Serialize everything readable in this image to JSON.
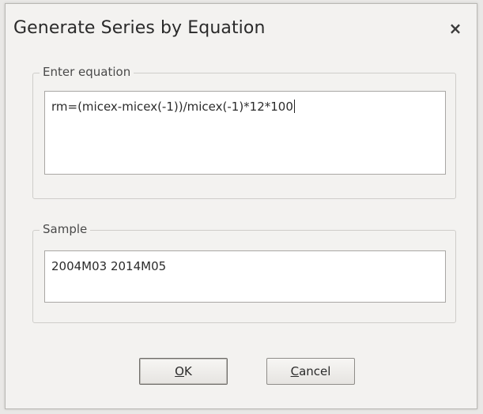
{
  "dialog": {
    "title": "Generate Series by Equation",
    "close_icon": "close-icon"
  },
  "equation_group": {
    "label": "Enter equation",
    "value": "rm=(micex-micex(-1))/micex(-1)*12*100"
  },
  "sample_group": {
    "label": "Sample",
    "value": "2004M03 2014M05"
  },
  "buttons": {
    "ok_mnemonic": "O",
    "ok_rest": "K",
    "cancel_mnemonic": "C",
    "cancel_rest": "ancel"
  },
  "close_glyph": "×"
}
